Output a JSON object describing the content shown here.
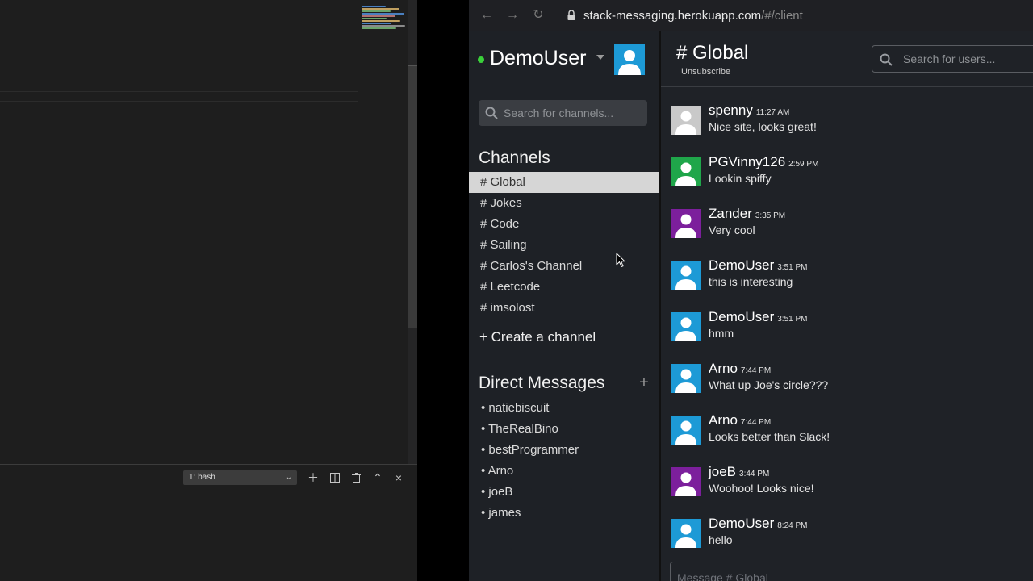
{
  "editor": {
    "terminal_select": "1: bash",
    "minimap_colors": [
      "#4a7fbf",
      "#c0a060",
      "#6aa36a",
      "#4a7fbf",
      "#b07070",
      "#6aa36a",
      "#c0a060",
      "#4a7fbf",
      "#8a8a8a",
      "#6aa36a"
    ]
  },
  "browser": {
    "url_host": "stack-messaging.herokuapp.com",
    "url_path": "/#/client"
  },
  "sidebar": {
    "username": "DemoUser",
    "channel_search_placeholder": "Search for channels...",
    "channels_title": "Channels",
    "channels": [
      {
        "label": "# Global",
        "active": true
      },
      {
        "label": "# Jokes"
      },
      {
        "label": "# Code"
      },
      {
        "label": "# Sailing"
      },
      {
        "label": "# Carlos's Channel"
      },
      {
        "label": "# Leetcode"
      },
      {
        "label": "# imsolost"
      }
    ],
    "create_channel": "+ Create a channel",
    "dm_title": "Direct Messages",
    "dm_add": "+",
    "direct_messages": [
      "• natiebiscuit",
      "• TheRealBino",
      "• bestProgrammer",
      "• Arno",
      "• joeB",
      "• james"
    ]
  },
  "main": {
    "channel_title": "# Global",
    "unsubscribe": "Unsubscribe",
    "user_search_placeholder": "Search for users...",
    "message_placeholder": "Message # Global",
    "messages": [
      {
        "author": "spenny",
        "time": "11:27 AM",
        "text": "Nice site, looks great!",
        "avatar_color": "#c9c9c9"
      },
      {
        "author": "PGVinny126",
        "time": "2:59 PM",
        "text": "Lookin spiffy",
        "avatar_color": "#1fa64a"
      },
      {
        "author": "Zander",
        "time": "3:35 PM",
        "text": "Very cool",
        "avatar_color": "#7c1f9c"
      },
      {
        "author": "DemoUser",
        "time": "3:51 PM",
        "text": "this is interesting",
        "avatar_color": "#1d9ad6"
      },
      {
        "author": "DemoUser",
        "time": "3:51 PM",
        "text": "hmm",
        "avatar_color": "#1d9ad6"
      },
      {
        "author": "Arno",
        "time": "7:44 PM",
        "text": "What up Joe's circle???",
        "avatar_color": "#1d9ad6"
      },
      {
        "author": "Arno",
        "time": "7:44 PM",
        "text": "Looks better than Slack!",
        "avatar_color": "#1d9ad6"
      },
      {
        "author": "joeB",
        "time": "3:44 PM",
        "text": "Woohoo! Looks nice!",
        "avatar_color": "#7c1f9c"
      },
      {
        "author": "DemoUser",
        "time": "8:24 PM",
        "text": "hello",
        "avatar_color": "#1d9ad6"
      }
    ]
  },
  "colors": {
    "online": "#3ad13a",
    "user_avatar": "#1d9ad6",
    "active_channel_bg": "#d6d6d6"
  }
}
